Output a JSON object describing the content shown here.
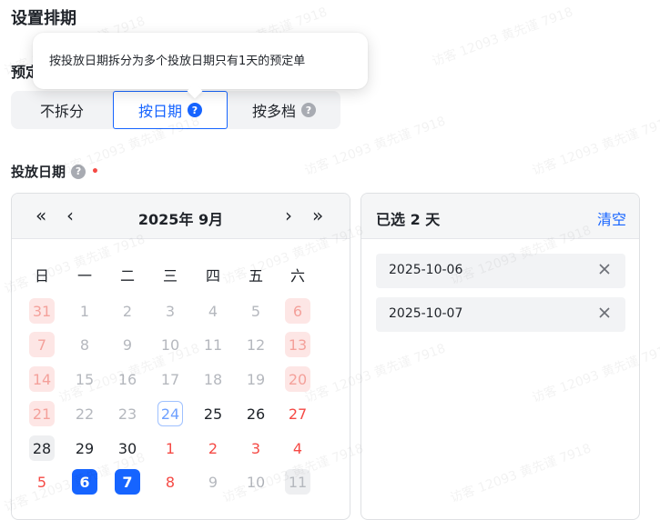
{
  "section_title": "设置排期",
  "hidden_label": "预定",
  "tooltip": "按投放日期拆分为多个投放日期只有1天的预定单",
  "split_options": [
    {
      "label": "不拆分",
      "help": false,
      "active": false
    },
    {
      "label": "按日期",
      "help": true,
      "active": true
    },
    {
      "label": "按多档",
      "help": true,
      "active": false
    }
  ],
  "field_label": "投放日期",
  "required_mark": "•",
  "calendar": {
    "title": "2025年 9月",
    "nav": {
      "prev_year": "«",
      "prev_month": "‹",
      "next_month": "›",
      "next_year": "»"
    },
    "weekdays": [
      "日",
      "一",
      "二",
      "三",
      "四",
      "五",
      "六"
    ],
    "weeks": [
      [
        {
          "d": "31",
          "s": "hol"
        },
        {
          "d": "1",
          "s": "muted"
        },
        {
          "d": "2",
          "s": "muted"
        },
        {
          "d": "3",
          "s": "muted"
        },
        {
          "d": "4",
          "s": "muted"
        },
        {
          "d": "5",
          "s": "muted"
        },
        {
          "d": "6",
          "s": "hol"
        }
      ],
      [
        {
          "d": "7",
          "s": "hol"
        },
        {
          "d": "8",
          "s": "muted"
        },
        {
          "d": "9",
          "s": "muted"
        },
        {
          "d": "10",
          "s": "muted"
        },
        {
          "d": "11",
          "s": "muted"
        },
        {
          "d": "12",
          "s": "muted"
        },
        {
          "d": "13",
          "s": "hol"
        }
      ],
      [
        {
          "d": "14",
          "s": "hol"
        },
        {
          "d": "15",
          "s": "muted"
        },
        {
          "d": "16",
          "s": "muted"
        },
        {
          "d": "17",
          "s": "muted"
        },
        {
          "d": "18",
          "s": "muted"
        },
        {
          "d": "19",
          "s": "muted"
        },
        {
          "d": "20",
          "s": "hol"
        }
      ],
      [
        {
          "d": "21",
          "s": "hol"
        },
        {
          "d": "22",
          "s": "muted"
        },
        {
          "d": "23",
          "s": "muted"
        },
        {
          "d": "24",
          "s": "today"
        },
        {
          "d": "25",
          "s": "normal"
        },
        {
          "d": "26",
          "s": "normal"
        },
        {
          "d": "27",
          "s": "red"
        }
      ],
      [
        {
          "d": "28",
          "s": "gray-bg"
        },
        {
          "d": "29",
          "s": "normal"
        },
        {
          "d": "30",
          "s": "normal"
        },
        {
          "d": "1",
          "s": "red"
        },
        {
          "d": "2",
          "s": "red"
        },
        {
          "d": "3",
          "s": "red"
        },
        {
          "d": "4",
          "s": "red"
        }
      ],
      [
        {
          "d": "5",
          "s": "red"
        },
        {
          "d": "6",
          "s": "selected"
        },
        {
          "d": "7",
          "s": "selected"
        },
        {
          "d": "8",
          "s": "red"
        },
        {
          "d": "9",
          "s": "muted"
        },
        {
          "d": "10",
          "s": "muted"
        },
        {
          "d": "11",
          "s": "gray-bg-muted"
        }
      ]
    ]
  },
  "selected_panel": {
    "title": "已选 2 天",
    "clear_label": "清空",
    "items": [
      "2025-10-06",
      "2025-10-07"
    ]
  },
  "watermark_text": "访客 12093  黄先谨 7918",
  "colors": {
    "accent": "#1664ff",
    "holiday_red": "#f54a45",
    "holiday_bg": "#fde6e5"
  }
}
